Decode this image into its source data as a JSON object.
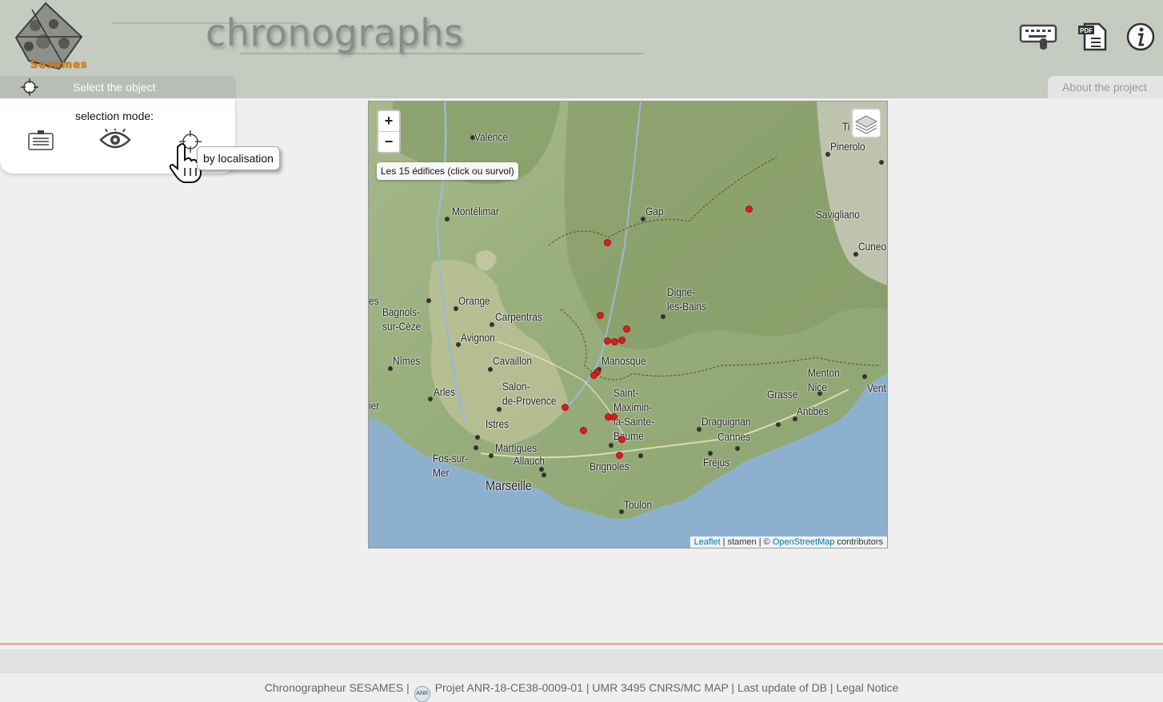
{
  "header": {
    "logo_text": "Sesames",
    "title": "chronographs",
    "icons": [
      "keyboard-mouse-icon",
      "pdf-document-icon",
      "info-icon"
    ]
  },
  "tabs": {
    "select_label": "Select the object",
    "about_label": "About the project"
  },
  "panel": {
    "title": "selection mode:",
    "modes": [
      "list-icon",
      "eye-icon",
      "target-icon"
    ],
    "tooltip": "by localisation"
  },
  "map": {
    "zoom_in": "+",
    "zoom_out": "−",
    "info": "Les 15 édifices (click ou survol)",
    "attribution": {
      "leaflet": "Leaflet",
      "sep1": " | stamen | © ",
      "osm": "OpenStreetMap",
      "tail": " contributors"
    },
    "cities": [
      "Valence",
      "Gap",
      "Montélimar",
      "Pinerolo",
      "Savigliano",
      "Cuneo",
      "Orange",
      "Carpentras",
      "Bagnols-\nsur-Cèze",
      "Avignon",
      "Digne-\nles-Bains",
      "Nîmes",
      "Cavaillon",
      "Manosque",
      "Arles",
      "Salon-\nde-Provence",
      "Saint-\nMaximin-\nla-Sainte-\nBaume",
      "Istres",
      "Martigues",
      "Allauch",
      "Fos-sur-\nMer",
      "Marseille",
      "Brignoles",
      "Draguignan",
      "Cannes",
      "Fréjus",
      "Grasse",
      "Antibes",
      "Menton\nNice",
      "Toulon",
      "Vent",
      "es",
      "ier",
      "Ti"
    ],
    "marker_count": 15,
    "colors": {
      "marker": "#d42020",
      "sea": "#7fa0c0"
    }
  },
  "footer": {
    "text1": "Chronographeur SESAMES |",
    "anr_logo": "ANR",
    "text2": "Projet ANR-18-CE38-0009-01 | UMR 3495 CNRS/MC MAP | Last update of DB | Legal Notice"
  }
}
